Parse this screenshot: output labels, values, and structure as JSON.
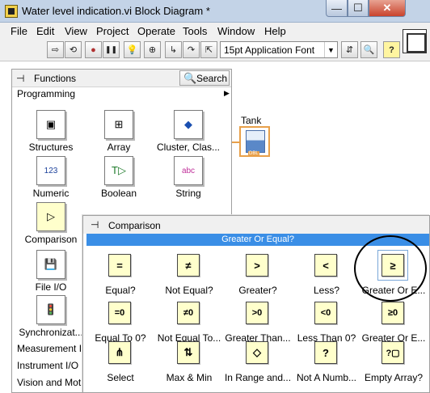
{
  "window": {
    "title": "Water level indication.vi Block Diagram *",
    "min_glyph": "—",
    "max_glyph": "☐",
    "close_glyph": "✕"
  },
  "menu": [
    "File",
    "Edit",
    "View",
    "Project",
    "Operate",
    "Tools",
    "Window",
    "Help"
  ],
  "toolbar": {
    "buttons": [
      {
        "name": "run-arrow-icon",
        "glyph": "⇨"
      },
      {
        "name": "run-continuously-icon",
        "glyph": "⟲"
      },
      {
        "name": "abort-icon",
        "glyph": "●"
      },
      {
        "name": "pause-icon",
        "glyph": "❚❚"
      },
      {
        "name": "highlight-execution-icon",
        "glyph": "💡"
      },
      {
        "name": "retain-wire-values-icon",
        "glyph": "⊕"
      },
      {
        "name": "step-into-icon",
        "glyph": "↳"
      },
      {
        "name": "step-over-icon",
        "glyph": "↷"
      },
      {
        "name": "step-out-icon",
        "glyph": "⇱"
      }
    ],
    "font_value": "15pt Application Font",
    "right_buttons": [
      {
        "name": "align-objects-icon",
        "glyph": "⇵"
      },
      {
        "name": "search-help-icon",
        "glyph": "🔍"
      },
      {
        "name": "context-help-icon",
        "glyph": "?"
      }
    ]
  },
  "diagram": {
    "tank_label": "Tank",
    "tank_type": "DBL"
  },
  "functions_palette": {
    "title": "Functions",
    "search_label": "Search",
    "category": "Programming",
    "items": [
      {
        "label": "Structures",
        "icon": "structures-icon",
        "glyph": "▣"
      },
      {
        "label": "Array",
        "icon": "array-icon",
        "glyph": "⊞"
      },
      {
        "label": "Cluster, Clas...",
        "icon": "cluster-icon",
        "glyph": "◆"
      },
      {
        "label": "Numeric",
        "icon": "numeric-icon",
        "glyph": "123"
      },
      {
        "label": "Boolean",
        "icon": "boolean-icon",
        "glyph": "T▷"
      },
      {
        "label": "String",
        "icon": "string-icon",
        "glyph": "abc"
      },
      {
        "label": "Comparison",
        "icon": "comparison-icon",
        "glyph": "▷"
      },
      {
        "label": "File I/O",
        "icon": "file-io-icon",
        "glyph": "💾"
      },
      {
        "label": "Synchronizat...",
        "icon": "synchronization-icon",
        "glyph": "🚦"
      }
    ],
    "subpalettes": [
      "Measurement I/",
      "Instrument I/O",
      "Vision and Mot"
    ]
  },
  "comparison_palette": {
    "title": "Comparison",
    "tooltip": "Greater Or Equal?",
    "items": [
      {
        "label": "Equal?",
        "icon": "equal-icon",
        "glyph": "="
      },
      {
        "label": "Not Equal?",
        "icon": "not-equal-icon",
        "glyph": "≠"
      },
      {
        "label": "Greater?",
        "icon": "greater-icon",
        "glyph": ">"
      },
      {
        "label": "Less?",
        "icon": "less-icon",
        "glyph": "<"
      },
      {
        "label": "Greater Or E...",
        "icon": "greater-or-equal-icon",
        "glyph": "≥"
      },
      {
        "label": "Equal To 0?",
        "icon": "equal-to-zero-icon",
        "glyph": "=0"
      },
      {
        "label": "Not Equal To...",
        "icon": "not-equal-to-zero-icon",
        "glyph": "≠0"
      },
      {
        "label": "Greater Than...",
        "icon": "greater-than-zero-icon",
        "glyph": ">0"
      },
      {
        "label": "Less Than 0?",
        "icon": "less-than-zero-icon",
        "glyph": "<0"
      },
      {
        "label": "Greater Or E...",
        "icon": "greater-or-equal-zero-icon",
        "glyph": "≥0"
      },
      {
        "label": "Select",
        "icon": "select-icon",
        "glyph": "⋔"
      },
      {
        "label": "Max & Min",
        "icon": "max-min-icon",
        "glyph": "⇅"
      },
      {
        "label": "In Range and...",
        "icon": "in-range-icon",
        "glyph": "◇"
      },
      {
        "label": "Not A Numb...",
        "icon": "not-a-number-icon",
        "glyph": "?"
      },
      {
        "label": "Empty Array?",
        "icon": "empty-array-icon",
        "glyph": "?▢"
      }
    ]
  }
}
